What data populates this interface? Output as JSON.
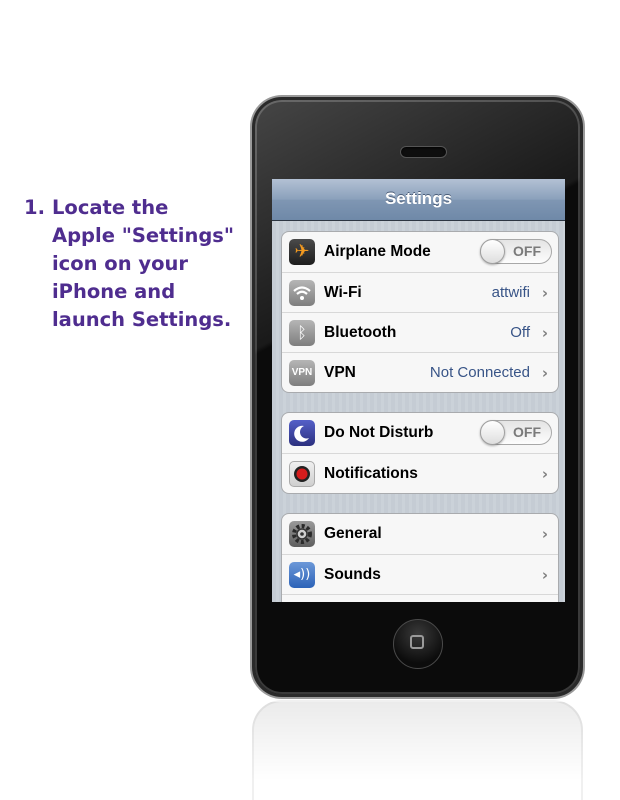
{
  "instruction": {
    "number": "1.",
    "lines": [
      "Locate the",
      "Apple \"Settings\"",
      "icon on your",
      "iPhone and",
      "launch Settings."
    ]
  },
  "phone": {
    "nav_title": "Settings",
    "groups": [
      {
        "rows": [
          {
            "label": "Airplane Mode",
            "icon": "airplane-icon",
            "toggle": "OFF"
          },
          {
            "label": "Wi-Fi",
            "icon": "wifi-icon",
            "value": "attwifi"
          },
          {
            "label": "Bluetooth",
            "icon": "bluetooth-icon",
            "value": "Off"
          },
          {
            "label": "VPN",
            "icon": "vpn-icon",
            "icon_text": "VPN",
            "value": "Not Connected"
          }
        ]
      },
      {
        "rows": [
          {
            "label": "Do Not Disturb",
            "icon": "moon-icon",
            "toggle": "OFF"
          },
          {
            "label": "Notifications",
            "icon": "notifications-icon"
          }
        ]
      },
      {
        "rows": [
          {
            "label": "General",
            "icon": "gear-icon"
          },
          {
            "label": "Sounds",
            "icon": "speaker-icon"
          }
        ]
      }
    ]
  },
  "colors": {
    "instruction_text": "#4f2d8f",
    "value_text": "#385487",
    "airplane_icon": "#f39a20"
  }
}
